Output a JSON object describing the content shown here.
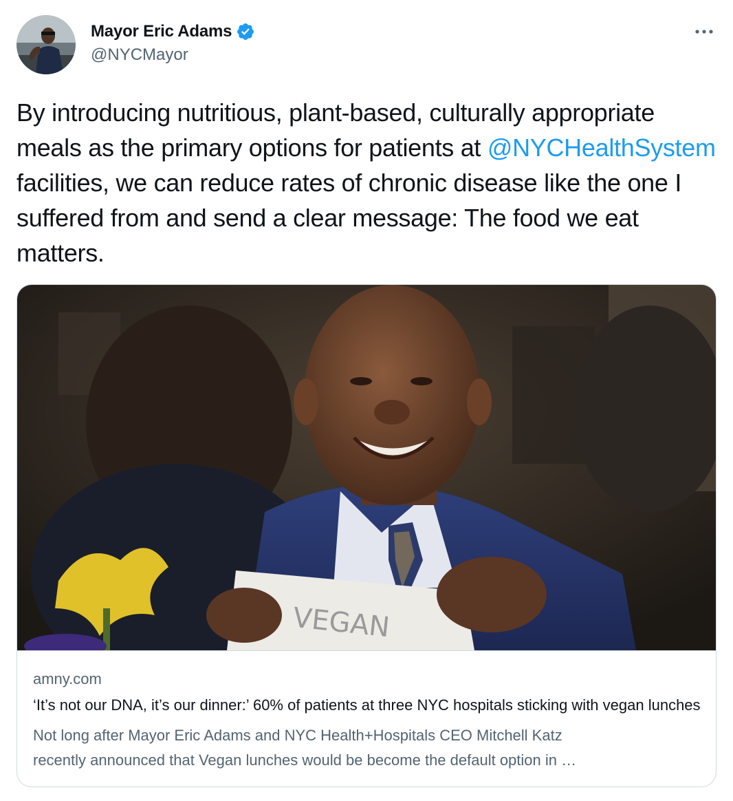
{
  "author": {
    "display_name": "Mayor Eric Adams",
    "handle": "@NYCMayor",
    "verified": true
  },
  "tweet": {
    "text_before": "By introducing nutritious, plant-based, culturally appropriate meals as the primary options for patients at ",
    "mention": "@NYCHealthSystem",
    "text_after": " facilities, we can reduce rates of chronic disease like the one I suffered from and send a clear message: The food we eat matters."
  },
  "link_card": {
    "domain": "amny.com",
    "title": "‘It’s not our DNA, it’s our dinner:’ 60% of patients at three NYC hospitals sticking with vegan lunches",
    "description_line1": "Not long after Mayor Eric Adams and NYC Health+Hospitals CEO Mitchell Katz",
    "description_line2": "recently announced that Vegan lunches would be become the default option in …",
    "image_sign_text": "VEGAN"
  },
  "icons": {
    "more": "more-horizontal-icon",
    "verified": "verified-badge-icon"
  },
  "colors": {
    "accent": "#1d9bf0",
    "text_primary": "#0f1419",
    "text_secondary": "#536471",
    "border": "#cfd9de"
  }
}
